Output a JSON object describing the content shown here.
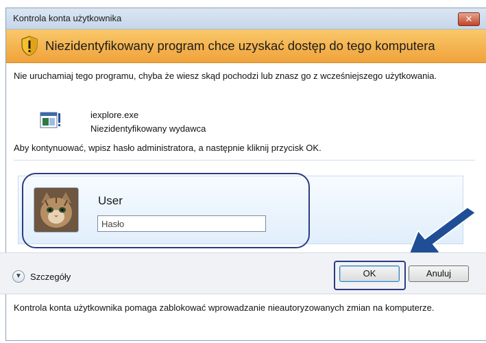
{
  "window": {
    "title": "Kontrola konta użytkownika",
    "close_glyph": "✕"
  },
  "banner": {
    "message": "Niezidentyfikowany program chce uzyskać dostęp do tego komputera",
    "icon": "shield-warning-icon"
  },
  "body": {
    "warning": "Nie uruchamiaj tego programu, chyba że wiesz skąd pochodzi lub znasz go z wcześniejszego użytkowania.",
    "program_name": "iexplore.exe",
    "publisher": "Niezidentyfikowany wydawca",
    "instruction": "Aby kontynuować, wpisz hasło administratora, a następnie kliknij przycisk OK."
  },
  "credentials": {
    "username": "User",
    "password_placeholder": "Hasło",
    "password_value": ""
  },
  "footer": {
    "details_label": "Szczegóły",
    "ok_label": "OK",
    "cancel_label": "Anuluj",
    "info": "Kontrola konta użytkownika pomaga zablokować wprowadzanie nieautoryzowanych zmian na komputerze."
  },
  "colors": {
    "banner": "#f0a23b",
    "highlight_ring": "#2b3b80",
    "arrow": "#1f4e96"
  }
}
